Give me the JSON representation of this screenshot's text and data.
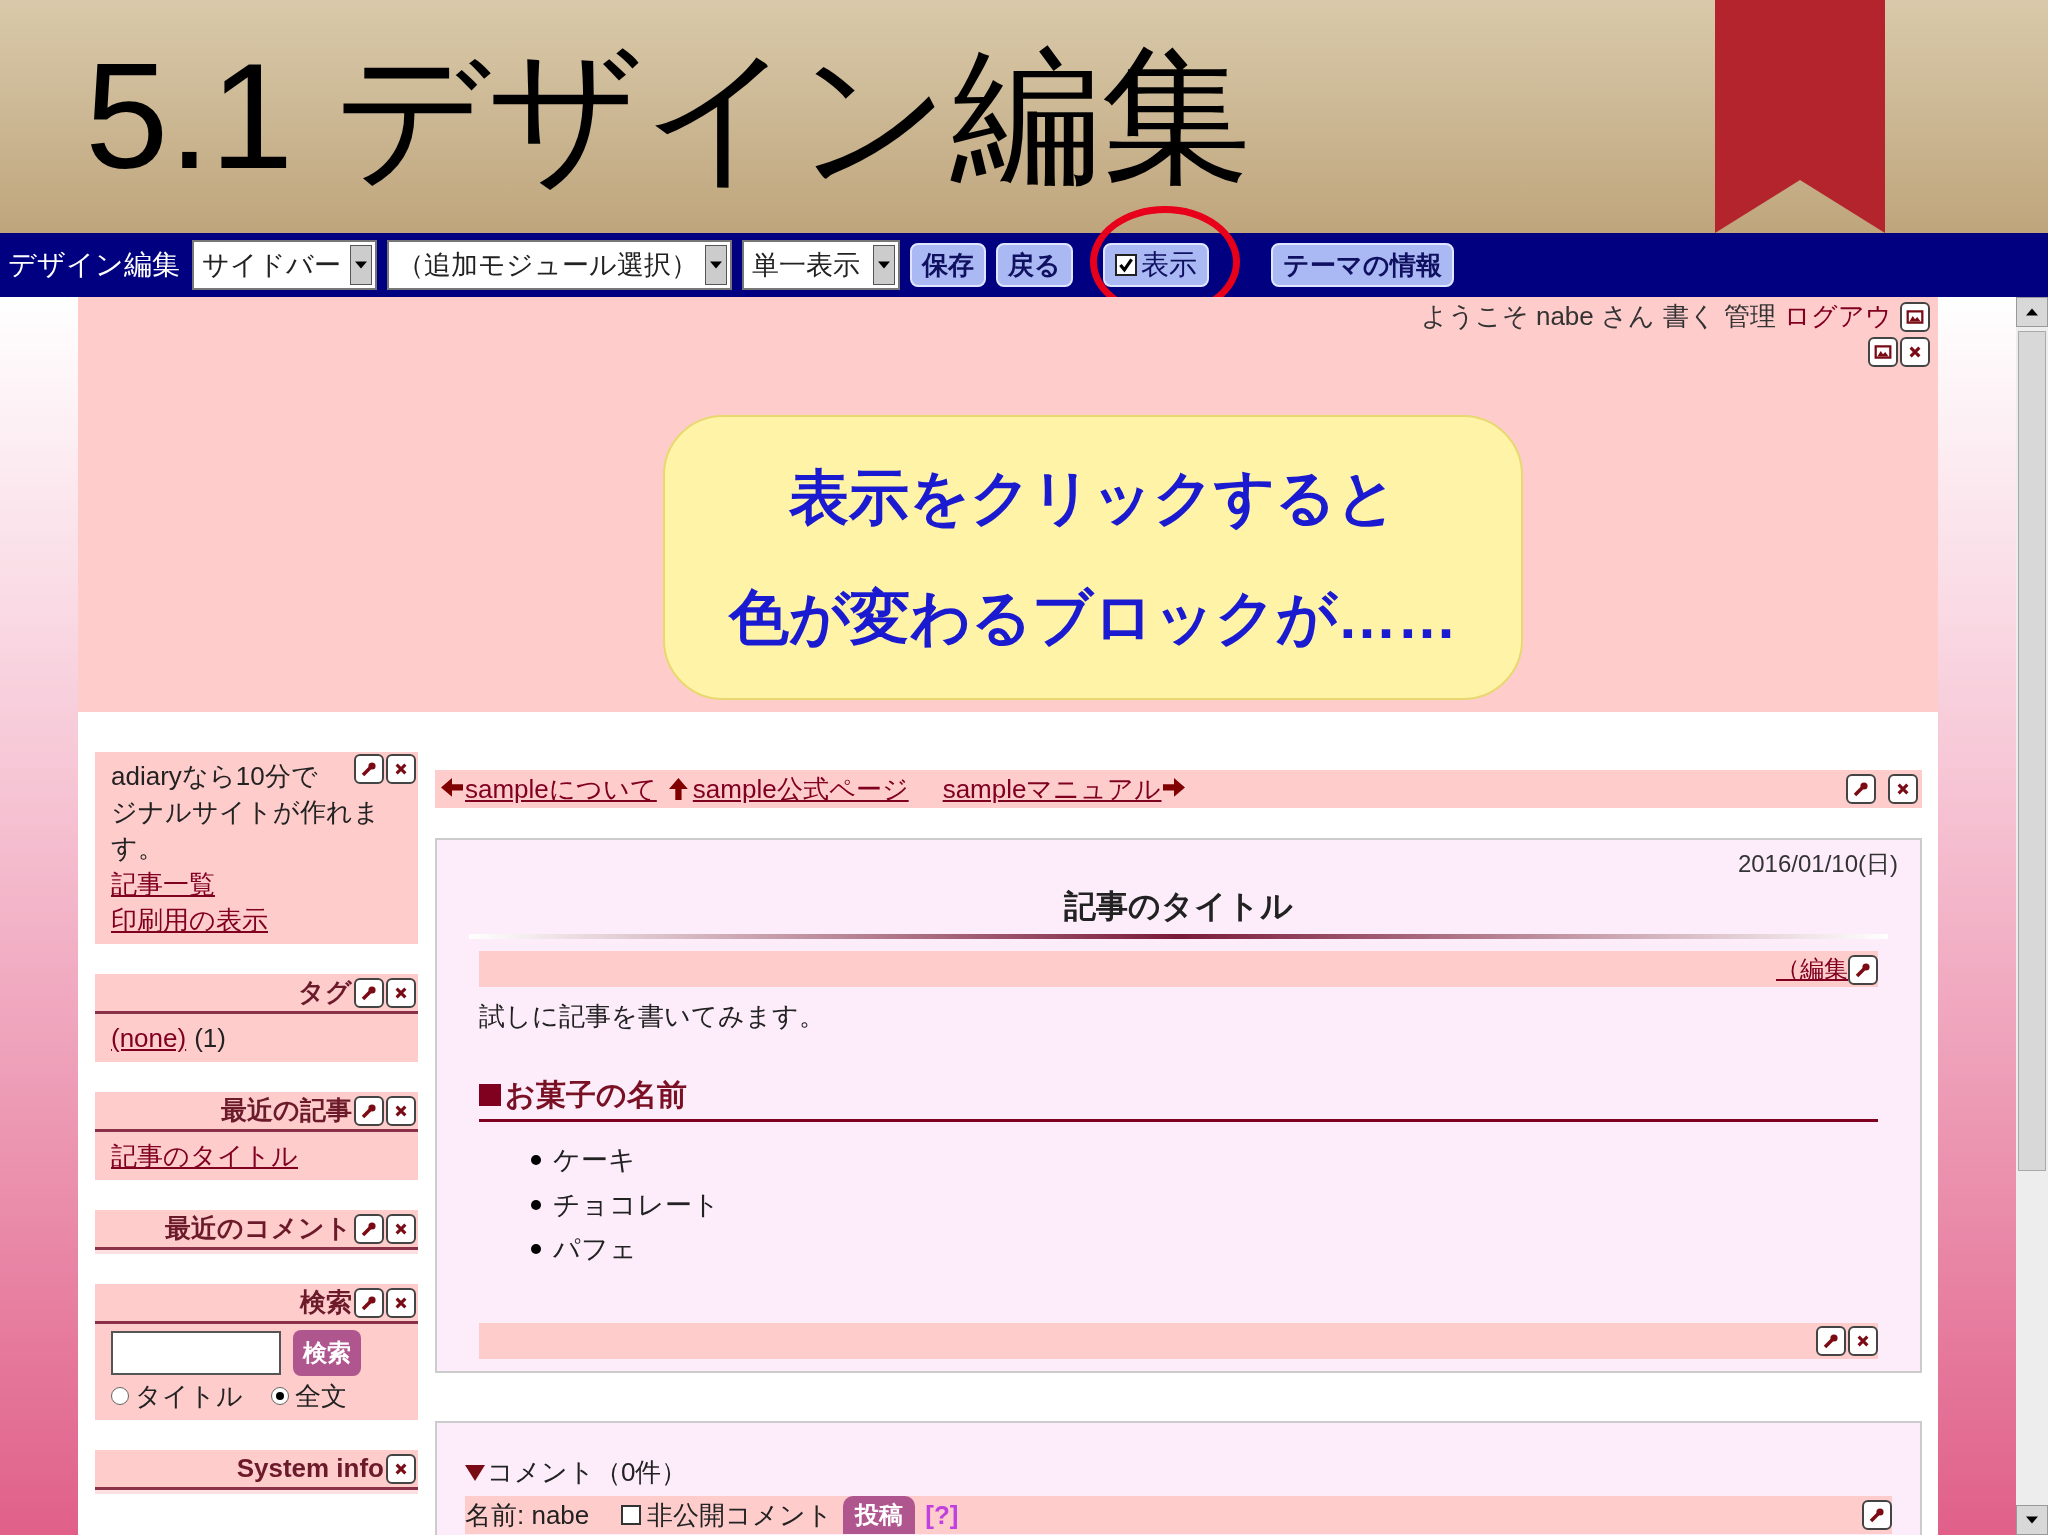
{
  "slide_title": "5.1 デザイン編集",
  "toolbar": {
    "label": "デザイン編集",
    "selects": [
      {
        "value": "サイドバー"
      },
      {
        "value": "（追加モジュール選択）"
      },
      {
        "value": "単一表示"
      }
    ],
    "buttons": [
      "保存",
      "戻る"
    ],
    "display_toggle": {
      "label": "表示",
      "checked": true
    },
    "theme_button": "テーマの情報"
  },
  "header": {
    "greeting": "ようこそ nabe さん",
    "links": [
      "書く",
      "管理",
      "ログアウ"
    ]
  },
  "callout": [
    "表示をクリックすると",
    "色が変わるブロックが……"
  ],
  "sidebar": [
    {
      "kind": "text",
      "closable": true,
      "editable": true,
      "lines": [
        "adiaryなら10分で",
        "ジナルサイトが作れま",
        "す。"
      ],
      "links": [
        "記事一覧",
        "印刷用の表示"
      ]
    },
    {
      "kind": "tags",
      "title": "タグ",
      "closable": true,
      "editable": true,
      "tag": "(none)",
      "count": "(1)"
    },
    {
      "kind": "links",
      "title": "最近の記事",
      "closable": true,
      "editable": true,
      "links": [
        "記事のタイトル"
      ]
    },
    {
      "kind": "empty",
      "title": "最近のコメント",
      "closable": true,
      "editable": true
    },
    {
      "kind": "search",
      "title": "検索",
      "closable": true,
      "editable": true,
      "button": "検索",
      "options": [
        {
          "label": "タイトル",
          "selected": false
        },
        {
          "label": "全文",
          "selected": true
        }
      ]
    },
    {
      "kind": "empty",
      "title": "System info",
      "closable": true,
      "editable": false
    }
  ],
  "nav_links": [
    {
      "label": "sampleについて",
      "kind": "left"
    },
    {
      "label": "sample公式ページ",
      "kind": "up"
    },
    {
      "label": "sampleマニュアル",
      "kind": "right"
    }
  ],
  "article": {
    "date": "2016/01/10(日)",
    "title": "記事のタイトル",
    "edit_link": "（編集",
    "body": "試しに記事を書いてみます。",
    "section_heading": "お菓子の名前",
    "items": [
      "ケーキ",
      "チョコレート",
      "パフェ"
    ]
  },
  "comments": {
    "heading": "コメント（0件）",
    "name_label": "名前: nabe",
    "private": {
      "label": "非公開コメント",
      "checked": false
    },
    "submit": "投稿",
    "help": "[?]"
  }
}
